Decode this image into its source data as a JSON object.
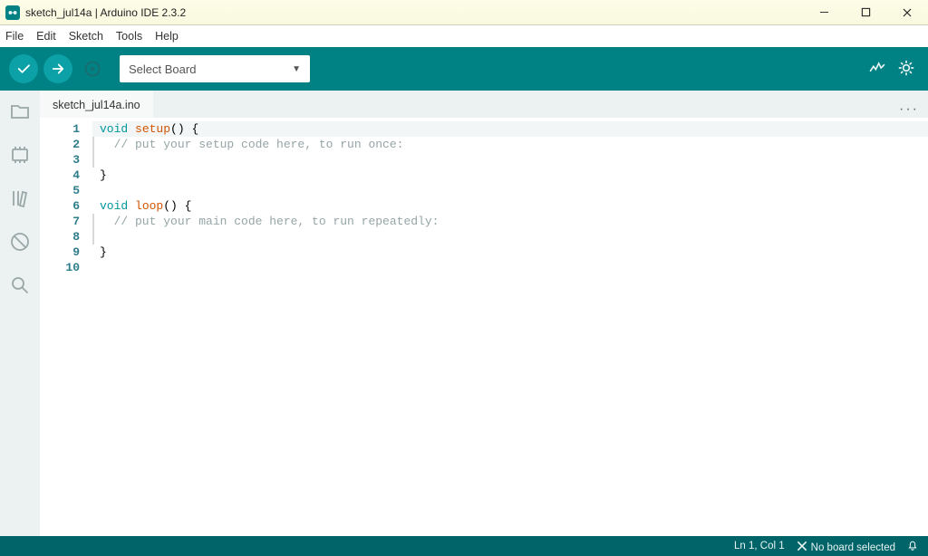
{
  "window": {
    "title": "sketch_jul14a | Arduino IDE 2.3.2"
  },
  "menu": {
    "file": "File",
    "edit": "Edit",
    "sketch": "Sketch",
    "tools": "Tools",
    "help": "Help"
  },
  "toolbar": {
    "board_placeholder": "Select Board"
  },
  "tabs": {
    "active": "sketch_jul14a.ino"
  },
  "code": {
    "line_count": 10,
    "lines": {
      "l1_kw": "void",
      "l1_fn": "setup",
      "l1_rest": "() {",
      "l2_cm": "  // put your setup code here, to run once:",
      "l3": "",
      "l4": "}",
      "l5": "",
      "l6_kw": "void",
      "l6_fn": "loop",
      "l6_rest": "() {",
      "l7_cm": "  // put your main code here, to run repeatedly:",
      "l8": "",
      "l9": "}",
      "l10": ""
    },
    "gutter": [
      "1",
      "2",
      "3",
      "4",
      "5",
      "6",
      "7",
      "8",
      "9",
      "10"
    ]
  },
  "status": {
    "cursor": "Ln 1, Col 1",
    "board": "No board selected"
  }
}
